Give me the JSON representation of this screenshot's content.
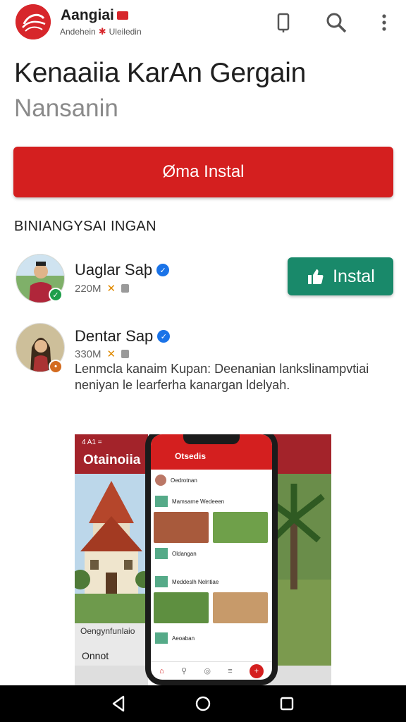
{
  "header": {
    "brand_name": "Aangiai",
    "brand_sub": "Andehein",
    "brand_sub2": "Uleiledin",
    "icons": [
      "logo-icon",
      "phone-icon",
      "search-icon",
      "more-vert-icon"
    ]
  },
  "app": {
    "title": "Kenaaiia KarAn Gergain",
    "subtitle": "Nansanin",
    "install_label": "Øma Instal"
  },
  "section": {
    "label": "BINIANGYSAI INGAN"
  },
  "rows": [
    {
      "name": "Uaglar Saþ",
      "size": "220M",
      "install_label": "Instal"
    },
    {
      "name": "Dentar Sap",
      "size": "330M",
      "description": "Lenmcla kanaim Kupan: Deenanian lankslinampvtiai neniyan le learferha kanargan ldelyah."
    }
  ],
  "preview": {
    "left_title": "Otainoiia",
    "left_status": "4 A1 =",
    "left_caption": "Oengynfunlaio",
    "left_caption2": "Onnot",
    "phone_title": "Otsedis",
    "phone_rows": [
      "Oedrotnan",
      "Mamsarne Wedeeen",
      "Oldangan",
      "Meddeslh Nelntiae",
      "Aeoaban"
    ]
  },
  "colors": {
    "primary_red": "#d41f1f",
    "install_green": "#19896a",
    "verified_blue": "#1a73e8"
  }
}
